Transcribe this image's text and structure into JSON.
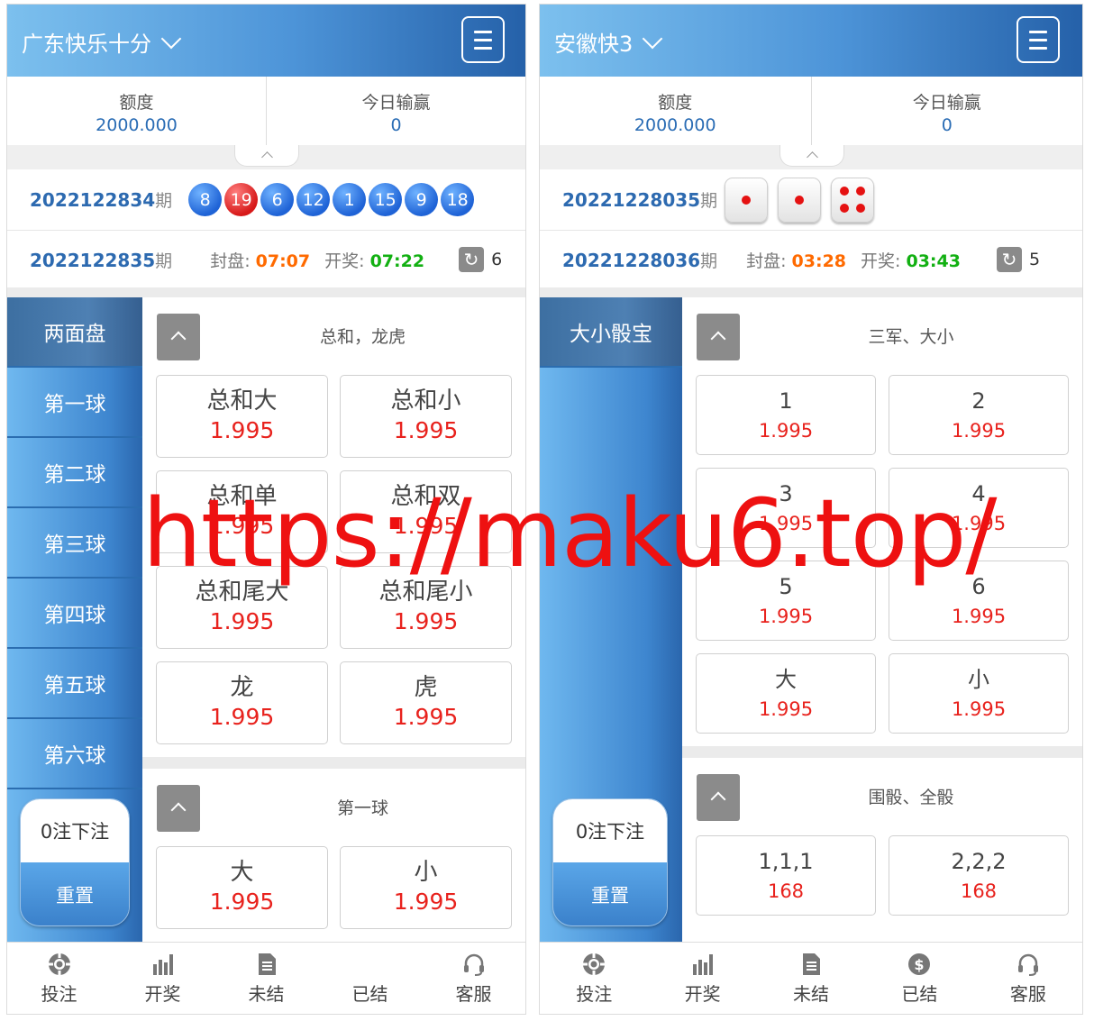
{
  "left": {
    "header_title": "广东快乐十分",
    "account": {
      "balance_label": "额度",
      "balance": "2000.000",
      "today_label": "今日输赢",
      "today": "0"
    },
    "last_issue": "2022122834",
    "issue_suffix": "期",
    "balls": [
      "8",
      "19",
      "6",
      "12",
      "1",
      "15",
      "9",
      "18"
    ],
    "balls_red": [
      false,
      true,
      false,
      false,
      false,
      false,
      false,
      false
    ],
    "next_issue": "2022122835",
    "close_label": "封盘:",
    "close_time": "07:07",
    "draw_label": "开奖:",
    "draw_time": "07:22",
    "refresh_count": "6",
    "sidebar": [
      "两面盘",
      "第一球",
      "第二球",
      "第三球",
      "第四球",
      "第五球",
      "第六球"
    ],
    "bet_count": "0注下注",
    "reset": "重置",
    "sections": [
      {
        "title": "总和，龙虎",
        "options": [
          {
            "name": "总和大",
            "odd": "1.995"
          },
          {
            "name": "总和小",
            "odd": "1.995"
          },
          {
            "name": "总和单",
            "odd": "1.995"
          },
          {
            "name": "总和双",
            "odd": "1.995"
          },
          {
            "name": "总和尾大",
            "odd": "1.995"
          },
          {
            "name": "总和尾小",
            "odd": "1.995"
          },
          {
            "name": "龙",
            "odd": "1.995"
          },
          {
            "name": "虎",
            "odd": "1.995"
          }
        ]
      },
      {
        "title": "第一球",
        "options": [
          {
            "name": "大",
            "odd": "1.995"
          },
          {
            "name": "小",
            "odd": "1.995"
          }
        ]
      }
    ],
    "nav": [
      "投注",
      "开奖",
      "未结",
      "已结",
      "客服"
    ],
    "nav_icons": [
      "chip-icon",
      "chart-icon",
      "document-icon",
      "",
      "headset-icon"
    ]
  },
  "right": {
    "header_title": "安徽快3",
    "account": {
      "balance_label": "额度",
      "balance": "2000.000",
      "today_label": "今日输赢",
      "today": "0"
    },
    "last_issue": "20221228035",
    "issue_suffix": "期",
    "dice": [
      1,
      1,
      4
    ],
    "next_issue": "20221228036",
    "close_label": "封盘:",
    "close_time": "03:28",
    "draw_label": "开奖:",
    "draw_time": "03:43",
    "refresh_count": "5",
    "sidebar": [
      "大小骰宝"
    ],
    "bet_count": "0注下注",
    "reset": "重置",
    "sections": [
      {
        "title": "三军、大小",
        "options": [
          {
            "name": "1",
            "odd": "1.995"
          },
          {
            "name": "2",
            "odd": "1.995"
          },
          {
            "name": "3",
            "odd": "1.995"
          },
          {
            "name": "4",
            "odd": "1.995"
          },
          {
            "name": "5",
            "odd": "1.995"
          },
          {
            "name": "6",
            "odd": "1.995"
          },
          {
            "name": "大",
            "odd": "1.995"
          },
          {
            "name": "小",
            "odd": "1.995"
          }
        ]
      },
      {
        "title": "围骰、全骰",
        "options": [
          {
            "name": "1,1,1",
            "odd": "168"
          },
          {
            "name": "2,2,2",
            "odd": "168"
          }
        ]
      }
    ],
    "nav": [
      "投注",
      "开奖",
      "未结",
      "已结",
      "客服"
    ],
    "nav_icons": [
      "chip-icon",
      "chart-icon",
      "document-icon",
      "dollar-icon",
      "headset-icon"
    ]
  },
  "watermark": "https://maku6.top/",
  "colors": {
    "accent_blue": "#2d6ab0",
    "odds_red": "#e8221d",
    "close_orange": "#ff6a00",
    "draw_green": "#12b012"
  }
}
